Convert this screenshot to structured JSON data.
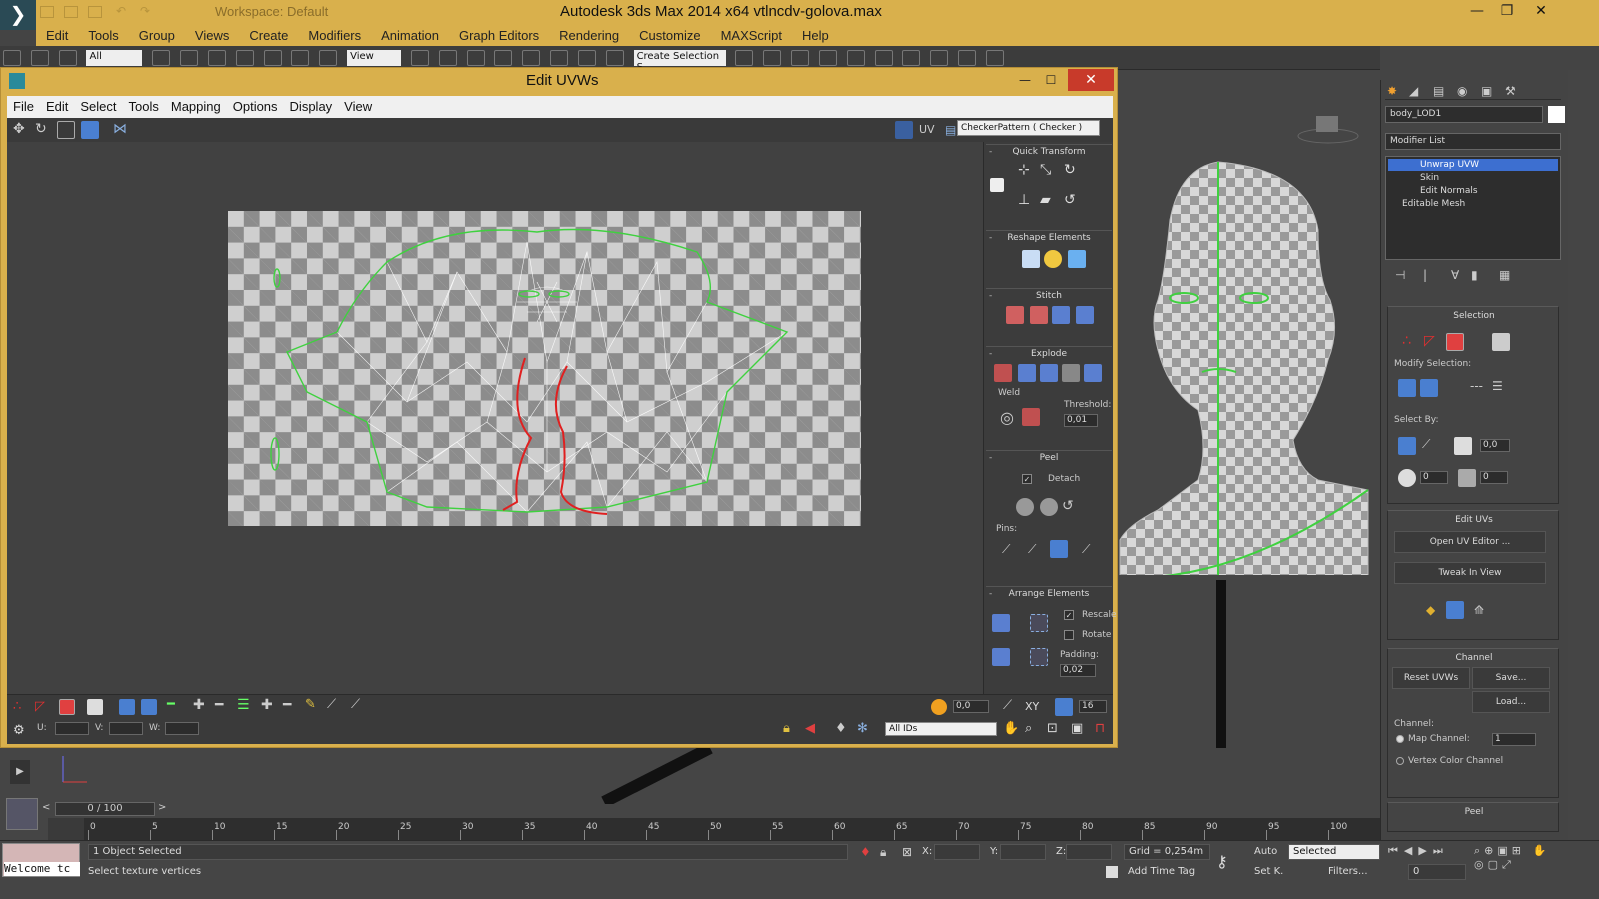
{
  "app": {
    "title": "Autodesk 3ds Max  2014 x64     vtlncdv-golova.max",
    "workspace": "Workspace: Default"
  },
  "main_menu": [
    "Edit",
    "Tools",
    "Group",
    "Views",
    "Create",
    "Modifiers",
    "Animation",
    "Graph Editors",
    "Rendering",
    "Customize",
    "MAXScript",
    "Help"
  ],
  "toolbar": {
    "filter": "All",
    "ref_coord": "View",
    "selection_set": "Create Selection S"
  },
  "uvw": {
    "title": "Edit UVWs",
    "menu": [
      "File",
      "Edit",
      "Select",
      "Tools",
      "Mapping",
      "Options",
      "Display",
      "View"
    ],
    "uv_label": "UV",
    "checker": "CheckerPattern  ( Checker )",
    "rollout": {
      "quick_transform": "Quick Transform",
      "reshape": "Reshape Elements",
      "stitch": "Stitch",
      "explode": "Explode",
      "weld": "Weld",
      "threshold_label": "Threshold:",
      "threshold": "0,01",
      "peel": "Peel",
      "detach": "Detach",
      "pins": "Pins:",
      "arrange": "Arrange Elements",
      "rescale": "Rescale",
      "rotate": "Rotate",
      "padding_label": "Padding:",
      "padding": "0,02"
    },
    "bottom": {
      "soft_value": "0,0",
      "xy_label": "XY",
      "grid_size": "16",
      "u_label": "U:",
      "v_label": "V:",
      "w_label": "W:",
      "ids": "All IDs"
    }
  },
  "command_panel": {
    "object_name": "body_LOD1",
    "modifier_list": "Modifier List",
    "stack": [
      "Unwrap UVW",
      "Skin",
      "Edit Normals",
      "Editable Mesh"
    ],
    "selection_title": "Selection",
    "modify_selection": "Modify Selection:",
    "select_by": "Select By:",
    "angle": "0,0",
    "val1": "0",
    "val2": "0",
    "edit_uvs": "Edit UVs",
    "open_uv_editor": "Open UV Editor ...",
    "tweak_in_view": "Tweak In View",
    "channel_title": "Channel",
    "reset_uvws": "Reset UVWs",
    "save": "Save...",
    "load": "Load...",
    "channel_label": "Channel:",
    "map_channel": "Map Channel:",
    "map_channel_value": "1",
    "vertex_color_channel": "Vertex Color Channel",
    "peel_title": "Peel"
  },
  "timeline": {
    "frame": "0 / 100",
    "ticks": [
      "0",
      "5",
      "10",
      "15",
      "20",
      "25",
      "30",
      "35",
      "40",
      "45",
      "50",
      "55",
      "60",
      "65",
      "70",
      "75",
      "80",
      "85",
      "90",
      "95",
      "100"
    ]
  },
  "status": {
    "welcome": "Welcome tc",
    "objects": "1 Object Selected",
    "prompt": "Select texture vertices",
    "x_label": "X:",
    "y_label": "Y:",
    "z_label": "Z:",
    "grid": "Grid = 0,254m",
    "add_time_tag": "Add Time Tag",
    "auto": "Auto",
    "set_key": "Set K.",
    "selected": "Selected",
    "filters": "Filters...",
    "frame_field": "0"
  },
  "colors": {
    "title_bg": "#d9b04c",
    "uv_seam_green": "#3fd13f",
    "uv_red": "#e02020",
    "close_red": "#c83a2a"
  }
}
